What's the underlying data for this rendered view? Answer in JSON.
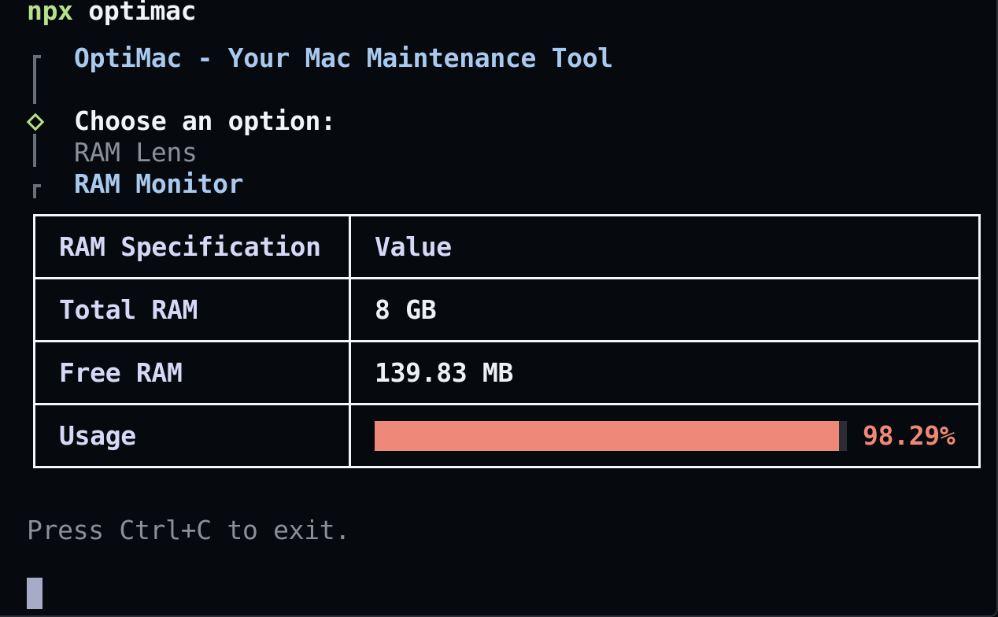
{
  "command": {
    "prefix": "npx",
    "name": "optimac"
  },
  "app": {
    "title": "OptiMac - Your Mac Maintenance Tool"
  },
  "menu": {
    "prompt": "Choose an option:",
    "options": [
      {
        "label": "RAM Lens",
        "state": "dim"
      },
      {
        "label": "RAM Monitor",
        "state": "selected"
      }
    ]
  },
  "ram_table": {
    "headers": [
      "RAM Specification",
      "Value"
    ],
    "rows": [
      {
        "spec": "Total RAM",
        "value": "8 GB"
      },
      {
        "spec": "Free RAM",
        "value": "139.83 MB"
      },
      {
        "spec": "Usage",
        "value": "98.29%",
        "usage_fraction": 0.9829
      }
    ]
  },
  "footer": {
    "hint": "Press Ctrl+C to exit."
  },
  "colors": {
    "accent_green": "#b7e08a",
    "accent_blue": "#a9c9ee",
    "usage_bar": "#ee8878",
    "background": "#06090d"
  },
  "icons": {
    "prompt_marker": "diamond-icon"
  }
}
